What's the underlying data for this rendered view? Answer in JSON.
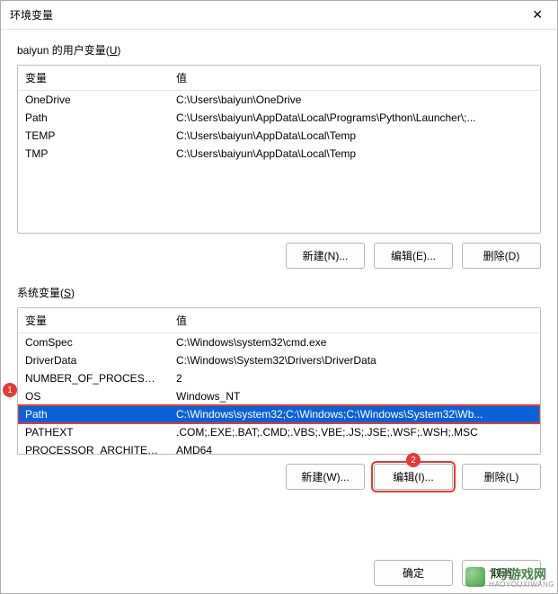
{
  "dialog": {
    "title": "环境变量"
  },
  "user_section": {
    "label_prefix": "baiyun 的用户变量(",
    "label_key": "U",
    "label_suffix": ")",
    "columns": {
      "variable": "变量",
      "value": "值"
    },
    "rows": [
      {
        "name": "OneDrive",
        "value": "C:\\Users\\baiyun\\OneDrive"
      },
      {
        "name": "Path",
        "value": "C:\\Users\\baiyun\\AppData\\Local\\Programs\\Python\\Launcher\\;..."
      },
      {
        "name": "TEMP",
        "value": "C:\\Users\\baiyun\\AppData\\Local\\Temp"
      },
      {
        "name": "TMP",
        "value": "C:\\Users\\baiyun\\AppData\\Local\\Temp"
      }
    ],
    "buttons": {
      "new": "新建(N)...",
      "edit": "编辑(E)...",
      "delete": "删除(D)"
    }
  },
  "sys_section": {
    "label_prefix": "系统变量(",
    "label_key": "S",
    "label_suffix": ")",
    "columns": {
      "variable": "变量",
      "value": "值"
    },
    "rows": [
      {
        "name": "ComSpec",
        "value": "C:\\Windows\\system32\\cmd.exe"
      },
      {
        "name": "DriverData",
        "value": "C:\\Windows\\System32\\Drivers\\DriverData"
      },
      {
        "name": "NUMBER_OF_PROCESSORS",
        "value": "2"
      },
      {
        "name": "OS",
        "value": "Windows_NT"
      },
      {
        "name": "Path",
        "value": "C:\\Windows\\system32;C:\\Windows;C:\\Windows\\System32\\Wb...",
        "selected": true
      },
      {
        "name": "PATHEXT",
        "value": ".COM;.EXE;.BAT;.CMD;.VBS;.VBE;.JS;.JSE;.WSF;.WSH;.MSC"
      },
      {
        "name": "PROCESSOR_ARCHITECT...",
        "value": "AMD64"
      }
    ],
    "buttons": {
      "new": "新建(W)...",
      "edit": "编辑(I)...",
      "delete": "删除(L)"
    }
  },
  "bottom": {
    "ok": "确定",
    "cancel": "取消"
  },
  "callouts": {
    "one": "1",
    "two": "2"
  },
  "watermark": {
    "brand": "7号游戏网",
    "sub": "HAOYOUXIWANG"
  }
}
